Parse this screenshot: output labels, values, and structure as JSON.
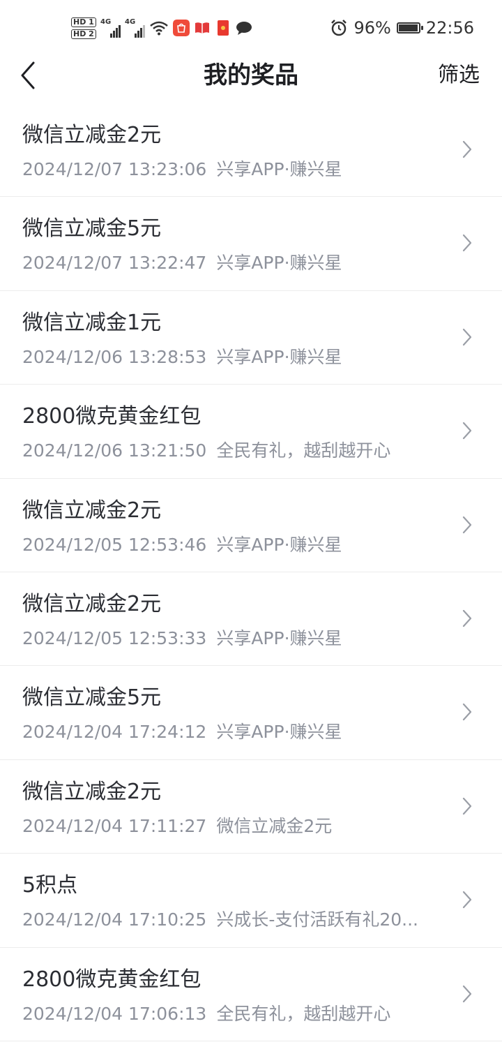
{
  "status_bar": {
    "sim1": "HD 1",
    "sim2": "HD 2",
    "net1": "4G",
    "net2": "4G",
    "battery_pct": "96%",
    "time": "22:56",
    "battery_level": 0.96
  },
  "header": {
    "title": "我的奖品",
    "filter_label": "筛选"
  },
  "prizes": [
    {
      "name": "微信立减金2元",
      "time": "2024/12/07 13:23:06",
      "source": "兴享APP·赚兴星"
    },
    {
      "name": "微信立减金5元",
      "time": "2024/12/07 13:22:47",
      "source": "兴享APP·赚兴星"
    },
    {
      "name": "微信立减金1元",
      "time": "2024/12/06 13:28:53",
      "source": "兴享APP·赚兴星"
    },
    {
      "name": "2800微克黄金红包",
      "time": "2024/12/06 13:21:50",
      "source": "全民有礼，越刮越开心"
    },
    {
      "name": "微信立减金2元",
      "time": "2024/12/05 12:53:46",
      "source": "兴享APP·赚兴星"
    },
    {
      "name": "微信立减金2元",
      "time": "2024/12/05 12:53:33",
      "source": "兴享APP·赚兴星"
    },
    {
      "name": "微信立减金5元",
      "time": "2024/12/04 17:24:12",
      "source": "兴享APP·赚兴星"
    },
    {
      "name": "微信立减金2元",
      "time": "2024/12/04 17:11:27",
      "source": "微信立减金2元"
    },
    {
      "name": "5积点",
      "time": "2024/12/04 17:10:25",
      "source": "兴成长-支付活跃有礼20..."
    },
    {
      "name": "2800微克黄金红包",
      "time": "2024/12/04 17:06:13",
      "source": "全民有礼，越刮越开心"
    }
  ]
}
